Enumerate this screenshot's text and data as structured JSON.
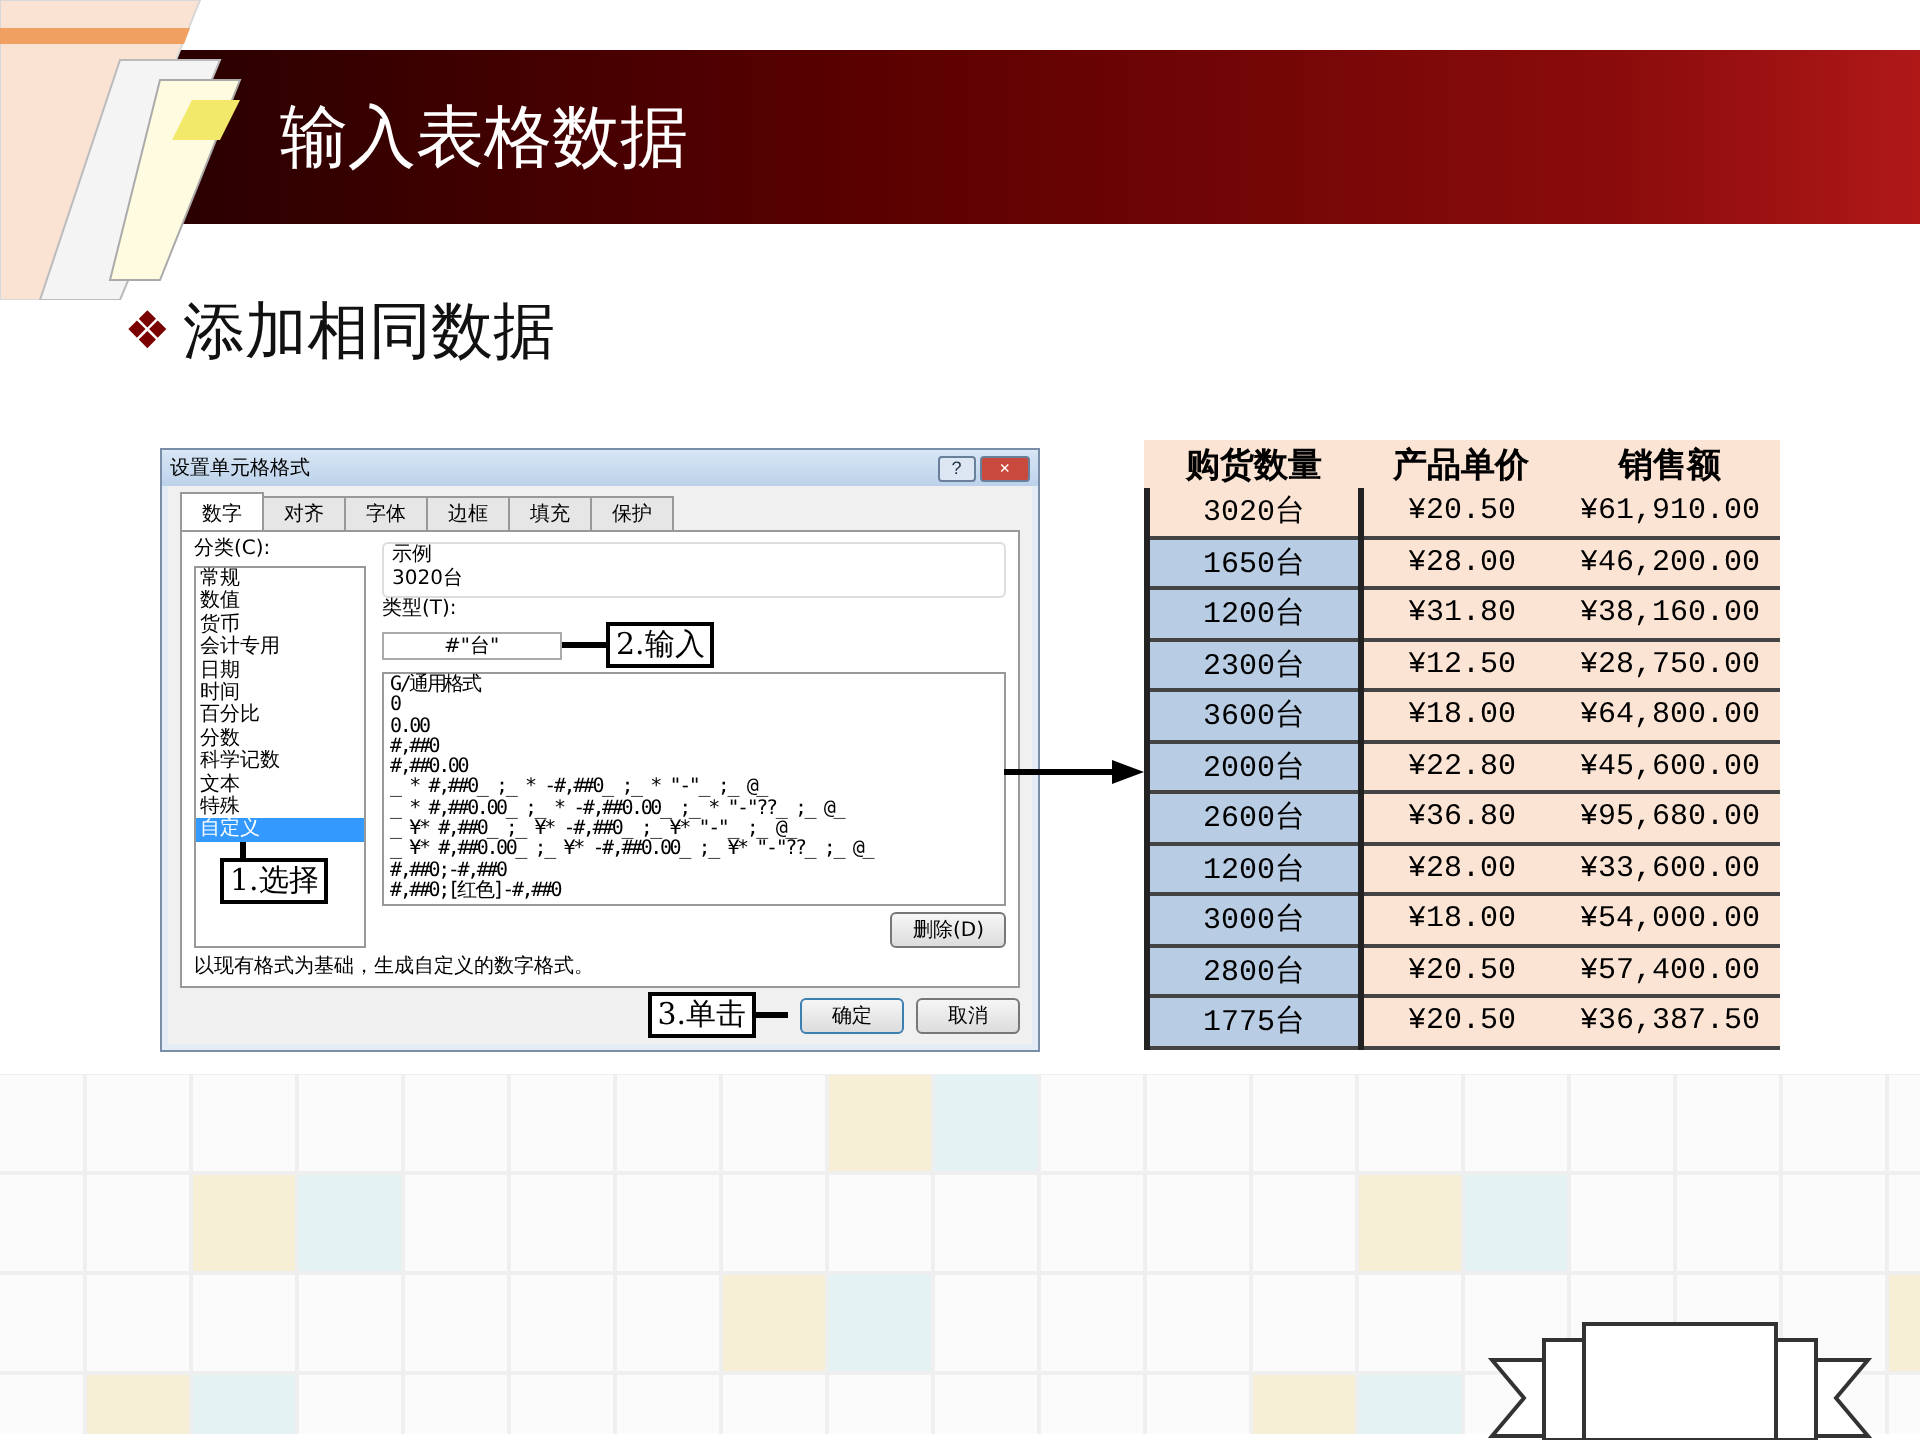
{
  "slide": {
    "title": "输入表格数据",
    "bullet": "❖",
    "subtitle": "添加相同数据"
  },
  "dialog": {
    "title": "设置单元格格式",
    "help_button": "?",
    "close_button": "×",
    "tabs": [
      {
        "label": "数字",
        "selected": true
      },
      {
        "label": "对齐",
        "selected": false
      },
      {
        "label": "字体",
        "selected": false
      },
      {
        "label": "边框",
        "selected": false
      },
      {
        "label": "填充",
        "selected": false
      },
      {
        "label": "保护",
        "selected": false
      }
    ],
    "category_label": "分类(C):",
    "categories": [
      {
        "label": "常规",
        "selected": false
      },
      {
        "label": "数值",
        "selected": false
      },
      {
        "label": "货币",
        "selected": false
      },
      {
        "label": "会计专用",
        "selected": false
      },
      {
        "label": "日期",
        "selected": false
      },
      {
        "label": "时间",
        "selected": false
      },
      {
        "label": "百分比",
        "selected": false
      },
      {
        "label": "分数",
        "selected": false
      },
      {
        "label": "科学记数",
        "selected": false
      },
      {
        "label": "文本",
        "selected": false
      },
      {
        "label": "特殊",
        "selected": false
      },
      {
        "label": "自定义",
        "selected": true
      }
    ],
    "sample_label": "示例",
    "sample_value": "3020台",
    "type_label": "类型(T):",
    "type_value": "#\"台\"",
    "formats": [
      "G/通用格式",
      "0",
      "0.00",
      "#,##0",
      "#,##0.00",
      "_ * #,##0_ ;_ * -#,##0_ ;_ * \"-\"_ ;_ @_",
      "_ * #,##0.00_ ;_ * -#,##0.00_ ;_ * \"-\"??_ ;_ @_",
      "_ ¥* #,##0_ ;_ ¥* -#,##0_ ;_ ¥* \"-\"_ ;_ @_",
      "_ ¥* #,##0.00_ ;_ ¥* -#,##0.00_ ;_ ¥* \"-\"??_ ;_ @_",
      "#,##0;-#,##0",
      "#,##0;[红色]-#,##0"
    ],
    "delete_button": "删除(D)",
    "description": "以现有格式为基础，生成自定义的数字格式。",
    "ok_button": "确定",
    "cancel_button": "取消"
  },
  "callouts": [
    {
      "label": "1.选择",
      "kind": "select"
    },
    {
      "label": "2.输入",
      "kind": "type"
    },
    {
      "label": "3.单击",
      "kind": "click"
    }
  ],
  "table": {
    "columns": [
      "购货数量",
      "产品单价",
      "销售额"
    ],
    "rows": [
      {
        "cells": [
          "3020台",
          "¥20.50",
          "¥61,910.00"
        ],
        "active": true
      },
      {
        "cells": [
          "1650台",
          "¥28.00",
          "¥46,200.00"
        ],
        "active": false
      },
      {
        "cells": [
          "1200台",
          "¥31.80",
          "¥38,160.00"
        ],
        "active": false
      },
      {
        "cells": [
          "2300台",
          "¥12.50",
          "¥28,750.00"
        ],
        "active": false
      },
      {
        "cells": [
          "3600台",
          "¥18.00",
          "¥64,800.00"
        ],
        "active": false
      },
      {
        "cells": [
          "2000台",
          "¥22.80",
          "¥45,600.00"
        ],
        "active": false
      },
      {
        "cells": [
          "2600台",
          "¥36.80",
          "¥95,680.00"
        ],
        "active": false
      },
      {
        "cells": [
          "1200台",
          "¥28.00",
          "¥33,600.00"
        ],
        "active": false
      },
      {
        "cells": [
          "3000台",
          "¥18.00",
          "¥54,000.00"
        ],
        "active": false
      },
      {
        "cells": [
          "2800台",
          "¥20.50",
          "¥57,400.00"
        ],
        "active": false
      },
      {
        "cells": [
          "1775台",
          "¥20.50",
          "¥36,387.50"
        ],
        "active": false
      }
    ]
  }
}
